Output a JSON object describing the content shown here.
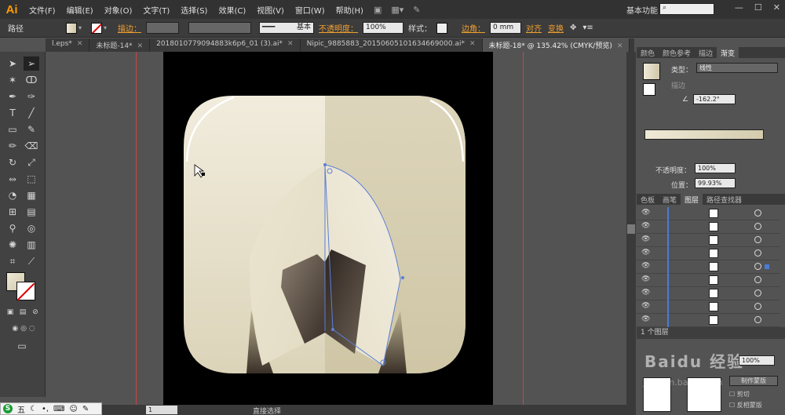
{
  "app": {
    "logo": "Ai",
    "workspace": "基本功能"
  },
  "menu": [
    "文件(F)",
    "编辑(E)",
    "对象(O)",
    "文字(T)",
    "选择(S)",
    "效果(C)",
    "视图(V)",
    "窗口(W)",
    "帮助(H)"
  ],
  "control_bar": {
    "selection_type": "路径",
    "stroke_label": "描边：",
    "stroke_profile": "基本",
    "opacity_label": "不透明度：",
    "opacity_value": "100%",
    "style_label": "样式：",
    "corner_label": "边角：",
    "corner_value": "0 mm",
    "align_label": "对齐",
    "transform_label": "变换"
  },
  "tabs": [
    {
      "label": "l.eps*",
      "active": false
    },
    {
      "label": "未标题-14*",
      "active": false
    },
    {
      "label": "20180107790948​83k6p6_01 (3).ai*",
      "active": false
    },
    {
      "label": "Nipic_9885883_20150605101634669000.ai*",
      "active": false
    },
    {
      "label": "未标题-18* @ 135.42% (CMYK/预览)",
      "active": true
    }
  ],
  "status": {
    "zoom": "135.42%",
    "page": "1",
    "tool": "直接选择"
  },
  "gradient_panel": {
    "tabs": [
      "颜色",
      "颜色参考",
      "描边",
      "渐变"
    ],
    "active_tab": "渐变",
    "type_label": "类型：",
    "type_value": "线性",
    "stroke_label": "描边",
    "angle_value": "-162.2°",
    "opacity_label": "不透明度：",
    "opacity_value": "100%",
    "location_label": "位置：",
    "location_value": "99.93%",
    "color_left": "#efe9d7",
    "color_right": "#d4cbad"
  },
  "layers_panel": {
    "tabs": [
      "色板",
      "画笔",
      "图层",
      "路径查找器"
    ],
    "active_tab": "图层",
    "footer": "1 个图层"
  },
  "transparency_panel": {
    "opacity_value": "100%",
    "make_mask_label": "制作蒙版",
    "clip_label": "剪切",
    "invert_label": "反相蒙版"
  },
  "watermark": {
    "title": "Baidu 经验",
    "sub": "jingyan.baidu.com"
  }
}
